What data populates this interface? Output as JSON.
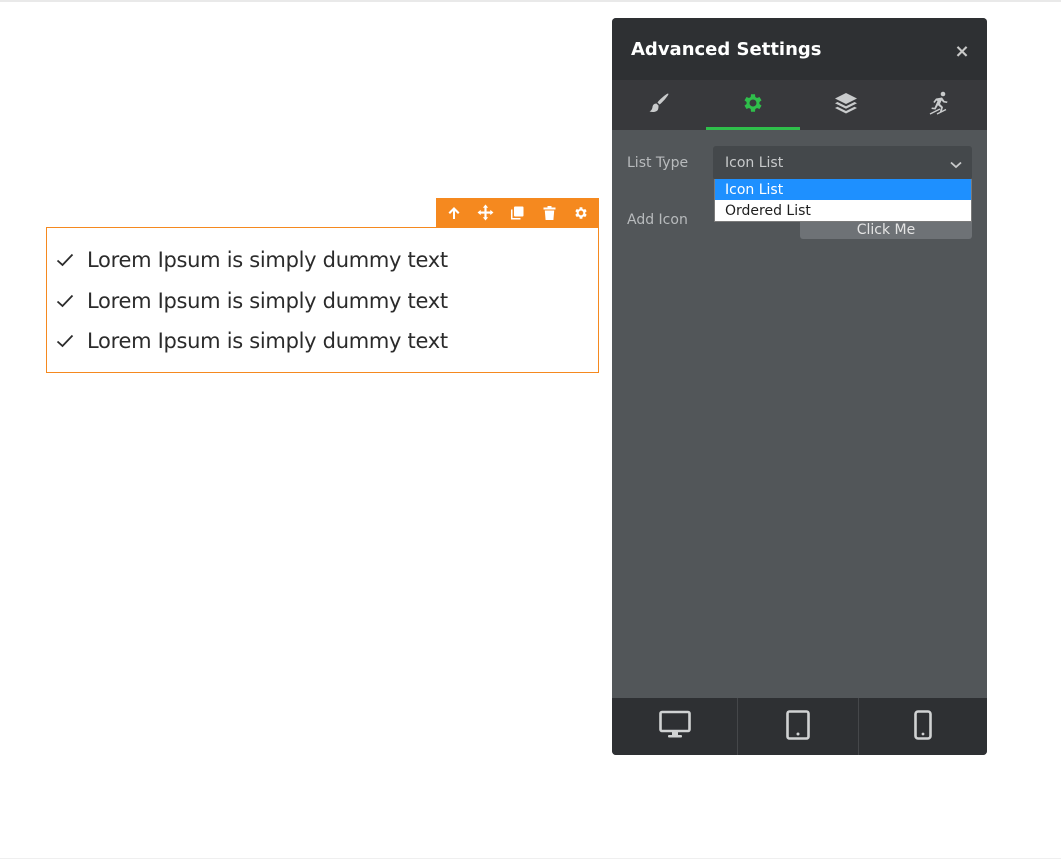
{
  "canvas": {
    "list_items": [
      {
        "text": "Lorem Ipsum is simply dummy text"
      },
      {
        "text": "Lorem Ipsum is simply dummy text"
      },
      {
        "text": "Lorem Ipsum is simply dummy text"
      }
    ],
    "toolbar_icons": [
      "arrow-up-icon",
      "move-icon",
      "copy-icon",
      "trash-icon",
      "gear-icon"
    ],
    "accent": "#f5891f"
  },
  "panel": {
    "title": "Advanced Settings",
    "close": "×",
    "tabs": [
      {
        "icon": "brush-icon",
        "active": false
      },
      {
        "icon": "gear-icon",
        "active": true
      },
      {
        "icon": "layers-icon",
        "active": false
      },
      {
        "icon": "motion-icon",
        "active": false
      }
    ],
    "active_color": "#2fbf4b",
    "list_type": {
      "label": "List Type",
      "value": "Icon List",
      "options": [
        "Icon List",
        "Ordered List"
      ],
      "selected_index": 0
    },
    "add_icon": {
      "label": "Add Icon",
      "button": "Click Me"
    },
    "devices": [
      "desktop-icon",
      "tablet-icon",
      "mobile-icon"
    ]
  }
}
